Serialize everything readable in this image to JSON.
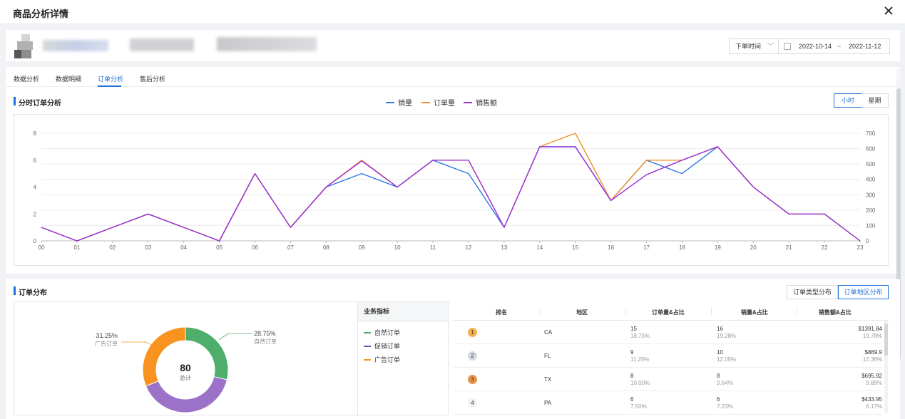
{
  "modal": {
    "title": "商品分析详情"
  },
  "filters": {
    "time_type": "下单时间",
    "date_start": "2022-10-14",
    "date_sep": "~",
    "date_end": "2022-11-12"
  },
  "tabs": [
    {
      "label": "数据分析",
      "active": false
    },
    {
      "label": "数据明细",
      "active": false
    },
    {
      "label": "订单分析",
      "active": true
    },
    {
      "label": "售后分析",
      "active": false
    }
  ],
  "hourly": {
    "title": "分时订单分析",
    "toggle": [
      "小时",
      "星期"
    ],
    "toggle_active": "小时"
  },
  "chart_data": {
    "type": "line",
    "title": "分时订单分析",
    "x": [
      "00",
      "01",
      "02",
      "03",
      "04",
      "05",
      "06",
      "07",
      "08",
      "09",
      "10",
      "11",
      "12",
      "13",
      "14",
      "15",
      "16",
      "17",
      "18",
      "19",
      "20",
      "21",
      "22",
      "23"
    ],
    "left_axis_ticks": [
      0,
      2,
      4,
      6,
      8
    ],
    "right_axis_ticks": [
      0,
      100,
      200,
      300,
      400,
      500,
      600,
      700
    ],
    "ylim": [
      0,
      8
    ],
    "y2lim": [
      0,
      700
    ],
    "legend_position": "top-center",
    "grid": true,
    "series": [
      {
        "name": "销量",
        "axis": "left",
        "color": "#2f78e4",
        "values": [
          1,
          0,
          1,
          2,
          1,
          0,
          5,
          1,
          4,
          5,
          4,
          6,
          5,
          1,
          7,
          7,
          3,
          6,
          5,
          7,
          4,
          2,
          2,
          0
        ]
      },
      {
        "name": "订单量",
        "axis": "left",
        "color": "#f0922a",
        "values": [
          1,
          0,
          1,
          2,
          1,
          0,
          5,
          1,
          4,
          6,
          4,
          6,
          6,
          1,
          7,
          8,
          3,
          6,
          6,
          7,
          4,
          2,
          2,
          0
        ]
      },
      {
        "name": "销售额",
        "axis": "right",
        "color": "#9b2fd9",
        "values": [
          87.5,
          0,
          87.5,
          175,
          87.5,
          0,
          437.5,
          87.5,
          350,
          520,
          350,
          525,
          525,
          87.5,
          612.5,
          612.5,
          262.5,
          430,
          525,
          612.5,
          350,
          175,
          175,
          0
        ]
      }
    ]
  },
  "distribution": {
    "title": "订单分布",
    "toggle": [
      "订单类型分布",
      "订单地区分布"
    ],
    "toggle_active": "订单地区分布",
    "total": "80",
    "total_label": "总计",
    "slices": [
      {
        "name": "自然订单",
        "percent_label": "28.75%",
        "percent": 28.75,
        "color": "#4eae6a"
      },
      {
        "name": "促销订单",
        "percent_label": "",
        "percent": 40.0,
        "color": "#9b72c8"
      },
      {
        "name": "广告订单",
        "percent_label": "31.25%",
        "percent": 31.25,
        "color": "#f7931e"
      }
    ],
    "metric_header": "业务指标",
    "metrics": [
      {
        "label": "自然订单",
        "color": "#4eae6a"
      },
      {
        "label": "促销订单",
        "color": "#7e4cc3"
      },
      {
        "label": "广告订单",
        "color": "#f7931e"
      }
    ]
  },
  "region_table": {
    "columns": [
      "排名",
      "地区",
      "订单量&占比",
      "销量&占比",
      "销售额&占比"
    ],
    "rows": [
      {
        "rank": "1",
        "rank_color": "#f5b04a",
        "region": "CA",
        "orders": "15",
        "orders_pct": "18.75%",
        "qty": "16",
        "qty_pct": "19.28%",
        "sales": "$1391.84",
        "sales_pct": "19.78%"
      },
      {
        "rank": "2",
        "rank_color": "#d6d9e0",
        "region": "FL",
        "orders": "9",
        "orders_pct": "11.25%",
        "qty": "10",
        "qty_pct": "12.05%",
        "sales": "$869.9",
        "sales_pct": "12.36%"
      },
      {
        "rank": "3",
        "rank_color": "#e8954c",
        "region": "TX",
        "orders": "8",
        "orders_pct": "10.00%",
        "qty": "8",
        "qty_pct": "9.64%",
        "sales": "$695.92",
        "sales_pct": "9.89%"
      },
      {
        "rank": "4",
        "rank_color": "#f1f1f3",
        "region": "PA",
        "orders": "6",
        "orders_pct": "7.50%",
        "qty": "6",
        "qty_pct": "7.23%",
        "sales": "$433.95",
        "sales_pct": "6.17%"
      }
    ]
  }
}
